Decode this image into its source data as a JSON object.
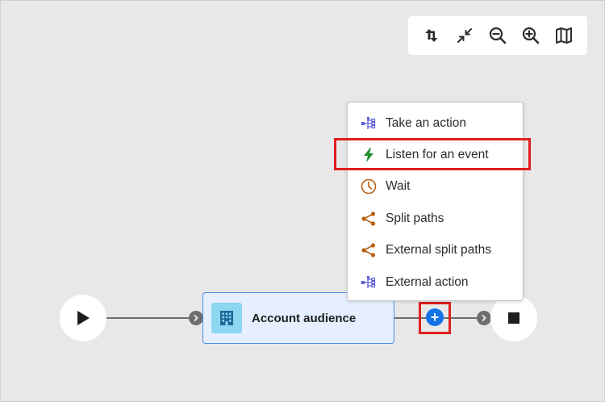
{
  "toolbar": {
    "buttons": [
      {
        "name": "reroute-icon"
      },
      {
        "name": "collapse-icon"
      },
      {
        "name": "zoom-out-icon"
      },
      {
        "name": "zoom-in-icon"
      },
      {
        "name": "map-icon"
      }
    ]
  },
  "nodes": {
    "audience": {
      "label": "Account audience",
      "icon": "building-icon",
      "accent": "#8ed7f2"
    },
    "start": {
      "icon": "play-icon"
    },
    "end": {
      "icon": "stop-icon"
    },
    "add_button": {
      "label": "+",
      "color": "#1473e6"
    }
  },
  "menu": {
    "items": [
      {
        "label": "Take an action",
        "icon": "action-icon",
        "color": "#5b5bd6"
      },
      {
        "label": "Listen for an event",
        "icon": "lightning-icon",
        "color": "#1a8f2c",
        "highlighted": true
      },
      {
        "label": "Wait",
        "icon": "clock-icon",
        "color": "#b85e14"
      },
      {
        "label": "Split paths",
        "icon": "share-icon",
        "color": "#b85e14"
      },
      {
        "label": "External split paths",
        "icon": "share-icon",
        "color": "#b85e14"
      },
      {
        "label": "External action",
        "icon": "action-icon",
        "color": "#5b5bd6"
      }
    ]
  },
  "highlight_color": "#e01e1e"
}
